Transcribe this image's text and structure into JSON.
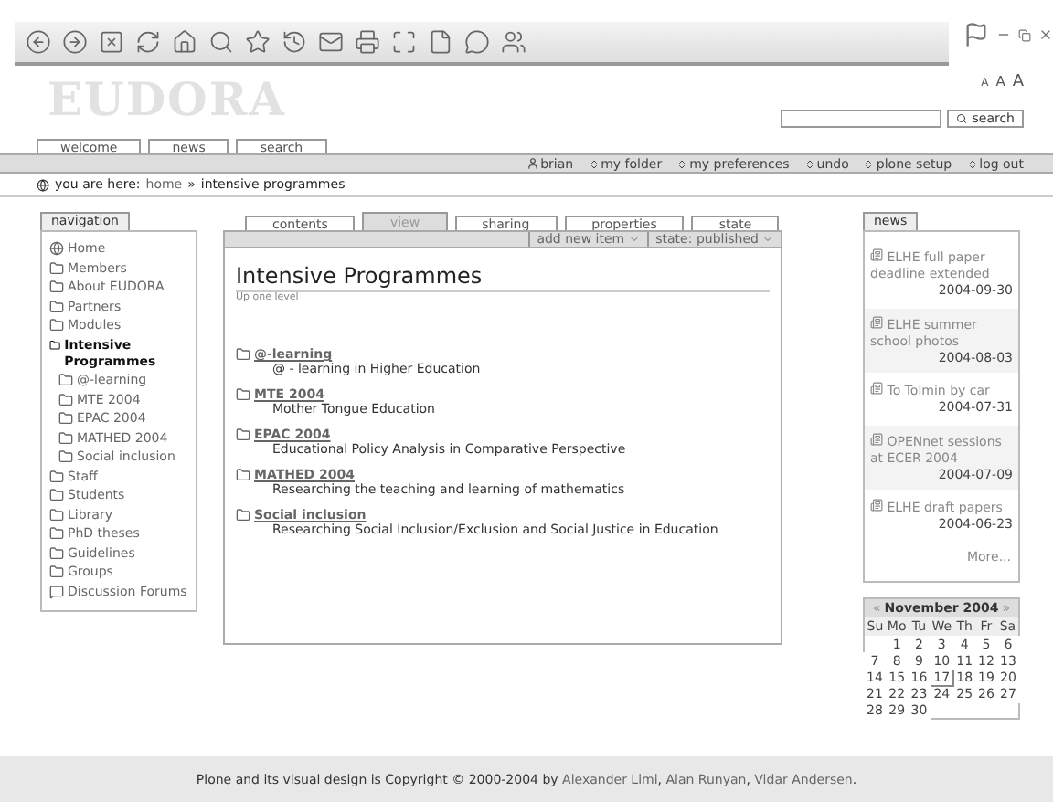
{
  "site": {
    "logo": "EUDORA",
    "text_sizes": [
      "A",
      "A",
      "A"
    ],
    "search_button": "search"
  },
  "site_tabs": [
    {
      "label": "welcome",
      "selected": false
    },
    {
      "label": "news",
      "selected": false
    },
    {
      "label": "search",
      "selected": false
    }
  ],
  "personal_bar": {
    "user": "brian",
    "links": [
      "my folder",
      "my preferences",
      "undo",
      "plone setup",
      "log out"
    ]
  },
  "breadcrumb": {
    "label": "you are here:",
    "items": [
      {
        "text": "home",
        "current": false
      },
      {
        "text": "intensive programmes",
        "current": true
      }
    ],
    "separator": "»"
  },
  "navigation": {
    "title": "navigation",
    "items": [
      {
        "kind": "home",
        "label": "Home",
        "selected": false
      },
      {
        "kind": "folder",
        "label": "Members",
        "selected": false
      },
      {
        "kind": "folder",
        "label": "About EUDORA",
        "selected": false
      },
      {
        "kind": "folder",
        "label": "Partners",
        "selected": false
      },
      {
        "kind": "folder",
        "label": "Modules",
        "selected": false
      },
      {
        "kind": "folder",
        "label": "Intensive Programmes",
        "selected": true,
        "children": [
          {
            "kind": "folder",
            "label": "@-learning",
            "selected": false
          },
          {
            "kind": "folder",
            "label": "MTE 2004",
            "selected": false
          },
          {
            "kind": "folder",
            "label": "EPAC 2004",
            "selected": false
          },
          {
            "kind": "folder",
            "label": "MATHED 2004",
            "selected": false
          },
          {
            "kind": "folder",
            "label": "Social inclusion",
            "selected": false
          }
        ]
      },
      {
        "kind": "folder",
        "label": "Staff",
        "selected": false
      },
      {
        "kind": "folder",
        "label": "Students",
        "selected": false
      },
      {
        "kind": "folder",
        "label": "Library",
        "selected": false
      },
      {
        "kind": "folder",
        "label": "PhD theses",
        "selected": false
      },
      {
        "kind": "folder",
        "label": "Guidelines",
        "selected": false
      },
      {
        "kind": "folder",
        "label": "Groups",
        "selected": false
      },
      {
        "kind": "discussion",
        "label": "Discussion Forums",
        "selected": false
      }
    ]
  },
  "content_tabs": [
    {
      "label": "contents",
      "selected": false
    },
    {
      "label": "view",
      "selected": true
    },
    {
      "label": "sharing",
      "selected": false
    },
    {
      "label": "properties",
      "selected": false
    },
    {
      "label": "state",
      "selected": false
    }
  ],
  "content_actions": [
    "add new item",
    "state: published"
  ],
  "content": {
    "title": "Intensive Programmes",
    "up_link": "Up one level",
    "folders": [
      {
        "title": "@-learning",
        "description": "@ - learning in Higher Education"
      },
      {
        "title": "MTE 2004",
        "description": "Mother Tongue Education"
      },
      {
        "title": "EPAC 2004",
        "description": "Educational Policy Analysis in Comparative Perspective"
      },
      {
        "title": "MATHED 2004",
        "description": "Researching the teaching and learning of mathematics"
      },
      {
        "title": "Social inclusion",
        "description": "Researching Social Inclusion/Exclusion and Social Justice in Education"
      }
    ]
  },
  "news": {
    "title": "news",
    "items": [
      {
        "title": "ELHE full paper deadline extended",
        "date": "2004-09-30"
      },
      {
        "title": "ELHE summer school photos",
        "date": "2004-08-03"
      },
      {
        "title": "To Tolmin by car",
        "date": "2004-07-31"
      },
      {
        "title": "OPENnet sessions at ECER 2004",
        "date": "2004-07-09"
      },
      {
        "title": "ELHE draft papers",
        "date": "2004-06-23"
      }
    ],
    "more": "More..."
  },
  "calendar": {
    "prev": "«",
    "month": "November 2004",
    "next": "»",
    "weekdays": [
      "Su",
      "Mo",
      "Tu",
      "We",
      "Th",
      "Fr",
      "Sa"
    ],
    "weeks": [
      [
        {
          "day": "1",
          "selected": false
        },
        {
          "day": "2",
          "selected": false
        },
        {
          "day": "3",
          "selected": false
        },
        {
          "day": "4",
          "selected": false
        },
        {
          "day": "5",
          "selected": false
        },
        {
          "day": "6",
          "selected": false
        }
      ],
      [
        {
          "day": "7",
          "selected": false
        },
        {
          "day": "8",
          "selected": false
        },
        {
          "day": "9",
          "selected": false
        },
        {
          "day": "10",
          "selected": false
        },
        {
          "day": "11",
          "selected": false
        },
        {
          "day": "12",
          "selected": false
        },
        {
          "day": "13",
          "selected": false
        }
      ],
      [
        {
          "day": "14",
          "selected": false
        },
        {
          "day": "15",
          "selected": false
        },
        {
          "day": "16",
          "selected": false
        },
        {
          "day": "17",
          "selected": true
        },
        {
          "day": "18",
          "selected": false
        },
        {
          "day": "19",
          "selected": false
        },
        {
          "day": "20",
          "selected": false
        }
      ],
      [
        {
          "day": "21",
          "selected": false
        },
        {
          "day": "22",
          "selected": false
        },
        {
          "day": "23",
          "selected": false
        },
        {
          "day": "24",
          "selected": false
        },
        {
          "day": "25",
          "selected": false
        },
        {
          "day": "26",
          "selected": false
        },
        {
          "day": "27",
          "selected": false
        }
      ],
      [
        {
          "day": "28",
          "selected": false
        },
        {
          "day": "29",
          "selected": false
        },
        {
          "day": "30",
          "selected": false
        }
      ]
    ]
  },
  "footer": {
    "prefix": "Plone and its visual design is Copyright © 2000-2004 by ",
    "authors": [
      "Alexander Limi",
      "Alan Runyan",
      "Vidar Andersen"
    ],
    "separator": ", ",
    "suffix": "."
  }
}
